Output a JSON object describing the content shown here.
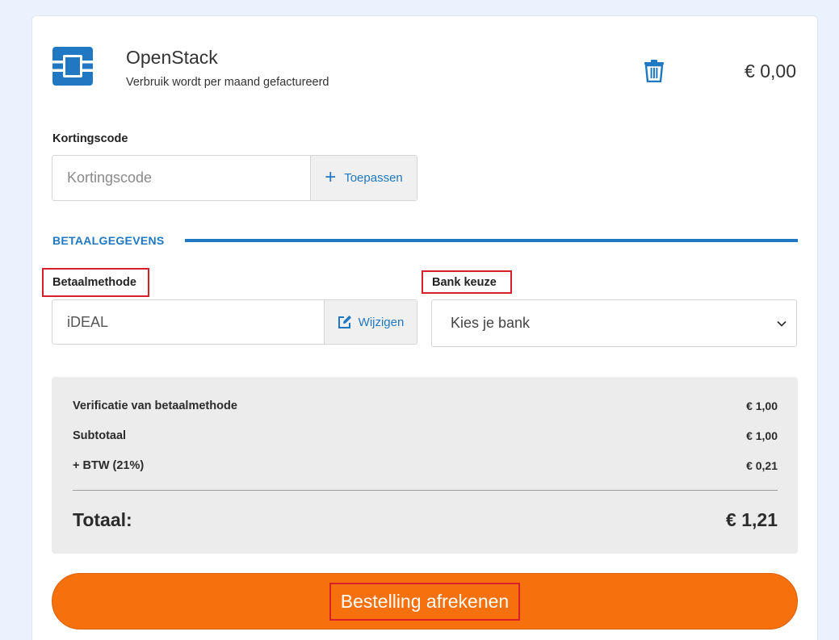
{
  "product": {
    "name": "OpenStack",
    "subtitle": "Verbruik wordt per maand gefactureerd",
    "price": "€ 0,00",
    "logo_icon": "openstack-logo",
    "delete_icon": "trash-icon"
  },
  "discount": {
    "label": "Kortingscode",
    "placeholder": "Kortingscode",
    "apply_label": "Toepassen"
  },
  "payment": {
    "section_title": "BETAALGEGEVENS",
    "method_label": "Betaalmethode",
    "method_value": "iDEAL",
    "change_label": "Wijzigen",
    "bank_label": "Bank keuze",
    "bank_placeholder": "Kies je bank"
  },
  "summary": {
    "rows": [
      {
        "label": "Verificatie van betaalmethode",
        "amount": "€ 1,00"
      },
      {
        "label": "Subtotaal",
        "amount": "€ 1,00"
      },
      {
        "label": "+ BTW (21%)",
        "amount": "€ 0,21"
      }
    ],
    "total_label": "Totaal:",
    "total_amount": "€ 1,21"
  },
  "checkout": {
    "label": "Bestelling afrekenen"
  },
  "colors": {
    "accent": "#1f78c1",
    "checkout": "#f6700e",
    "highlight": "#d6202a",
    "background": "#eaf3fd"
  }
}
